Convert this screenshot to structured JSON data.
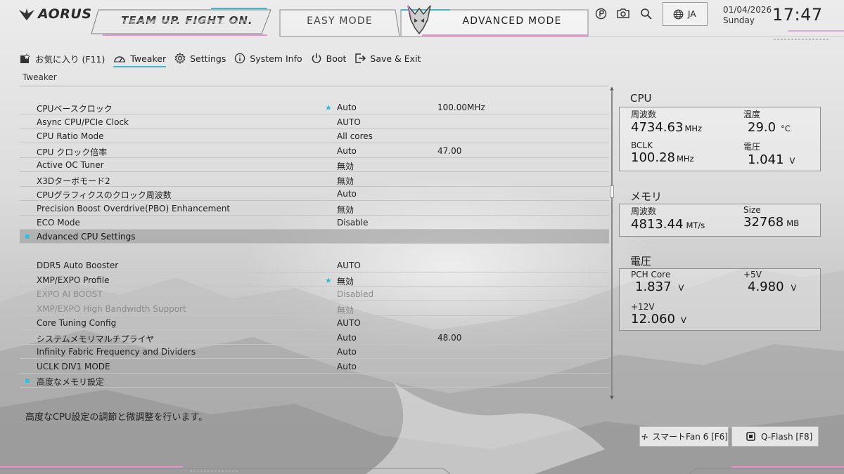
{
  "header": {
    "brand": "AORUS",
    "slogan": "TEAM UP. FIGHT ON.",
    "mode_easy": "EASY MODE",
    "mode_advanced": "ADVANCED MODE",
    "language": "JA",
    "date": "01/04/2026",
    "weekday": "Sunday",
    "time": "17:47"
  },
  "nav": [
    {
      "label": "お気に入り (F11)",
      "icon": "favorites-icon"
    },
    {
      "label": "Tweaker",
      "icon": "gauge-icon",
      "active": true
    },
    {
      "label": "Settings",
      "icon": "gear-icon"
    },
    {
      "label": "System Info",
      "icon": "info-icon"
    },
    {
      "label": "Boot",
      "icon": "power-icon"
    },
    {
      "label": "Save & Exit",
      "icon": "exit-icon"
    }
  ],
  "breadcrumb": "Tweaker",
  "settings": [
    {
      "name": "CPUベースクロック",
      "value": "Auto",
      "extra": "100.00MHz",
      "star": true
    },
    {
      "name": "Async CPU/PCIe Clock",
      "value": "AUTO",
      "extra": ""
    },
    {
      "name": "CPU Ratio Mode",
      "value": "All cores",
      "extra": ""
    },
    {
      "name": "CPU クロック倍率",
      "value": "Auto",
      "extra": "47.00"
    },
    {
      "name": "Active OC Tuner",
      "value": "無効",
      "extra": ""
    },
    {
      "name": "X3Dターボモード2",
      "value": "無効",
      "extra": ""
    },
    {
      "name": "CPUグラフィクスのクロック周波数",
      "value": "Auto",
      "extra": ""
    },
    {
      "name": "Precision Boost Overdrive(PBO) Enhancement",
      "value": "無効",
      "extra": ""
    },
    {
      "name": "ECO Mode",
      "value": "Disable",
      "extra": ""
    },
    {
      "name": "Advanced CPU Settings",
      "value": "",
      "extra": "",
      "submenu": true,
      "selected": true
    },
    {
      "name": "DDR5 Auto Booster",
      "value": "AUTO",
      "extra": ""
    },
    {
      "name": "XMP/EXPO Profile",
      "value": "無効",
      "extra": "",
      "star": true
    },
    {
      "name": "EXPO AI BOOST",
      "value": "Disabled",
      "extra": "",
      "disabled": true
    },
    {
      "name": "XMP/EXPO High Bandwidth Support",
      "value": "無効",
      "extra": "",
      "disabled": true
    },
    {
      "name": "Core Tuning Config",
      "value": "AUTO",
      "extra": ""
    },
    {
      "name": "システムメモリマルチプライヤ",
      "value": "Auto",
      "extra": "48.00"
    },
    {
      "name": "Infinity Fabric Frequency and Dividers",
      "value": "Auto",
      "extra": ""
    },
    {
      "name": "UCLK DIV1 MODE",
      "value": "Auto",
      "extra": ""
    },
    {
      "name": "高度なメモリ設定",
      "value": "",
      "extra": "",
      "submenu": true
    }
  ],
  "help_text": "高度なCPU設定の調節と微調整を行います。",
  "monitor": {
    "cpu": {
      "title": "CPU",
      "freq_label": "周波数",
      "freq_value": "4734.63",
      "freq_unit": "MHz",
      "temp_label": "温度",
      "temp_value": "29.0",
      "temp_unit": "°C",
      "bclk_label": "BCLK",
      "bclk_value": "100.28",
      "bclk_unit": "MHz",
      "volt_label": "電圧",
      "volt_value": "1.041",
      "volt_unit": "V"
    },
    "memory": {
      "title": "メモリ",
      "freq_label": "周波数",
      "freq_value": "4813.44",
      "freq_unit": "MT/s",
      "size_label": "Size",
      "size_value": "32768",
      "size_unit": "MB"
    },
    "voltage": {
      "title": "電圧",
      "pch_label": "PCH Core",
      "pch_value": "1.837",
      "pch_unit": "V",
      "v5_label": "+5V",
      "v5_value": "4.980",
      "v5_unit": "V",
      "v12_label": "+12V",
      "v12_value": "12.060",
      "v12_unit": "V"
    }
  },
  "buttons": {
    "smart_fan": "スマートFan 6 [F6]",
    "qflash": "Q-Flash [F8]"
  },
  "colors": {
    "accent": "#3fb7cf",
    "pink": "#e88fd0"
  }
}
